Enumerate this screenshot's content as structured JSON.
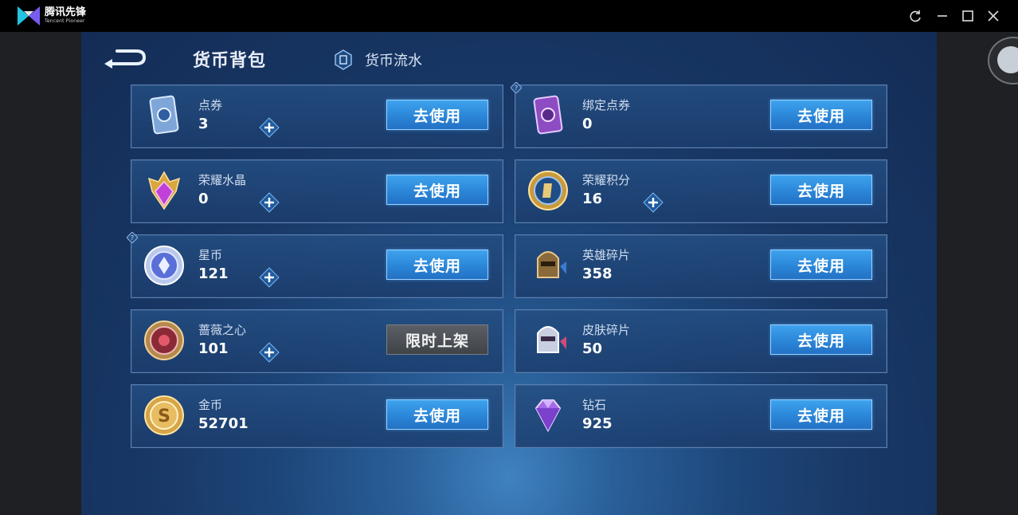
{
  "app": {
    "name": "腾讯先锋",
    "subtitle": "Tencent Pioneer"
  },
  "header": {
    "tab_wallet": "货币背包",
    "tab_flow": "货币流水"
  },
  "cards": [
    {
      "name": "点券",
      "value": "3",
      "button": "去使用",
      "has_plus": true,
      "icon": "coupon-card-icon"
    },
    {
      "name": "绑定点券",
      "value": "0",
      "button": "去使用",
      "has_plus": false,
      "icon": "bound-coupon-icon"
    },
    {
      "name": "荣耀水晶",
      "value": "0",
      "button": "去使用",
      "has_plus": true,
      "icon": "glory-crystal-icon"
    },
    {
      "name": "荣耀积分",
      "value": "16",
      "button": "去使用",
      "has_plus": true,
      "icon": "glory-points-icon"
    },
    {
      "name": "星币",
      "value": "121",
      "button": "去使用",
      "has_plus": true,
      "icon": "star-coin-icon"
    },
    {
      "name": "英雄碎片",
      "value": "358",
      "button": "去使用",
      "has_plus": false,
      "icon": "hero-fragment-icon"
    },
    {
      "name": "蔷薇之心",
      "value": "101",
      "button": "限时上架",
      "has_plus": true,
      "icon": "rose-heart-icon"
    },
    {
      "name": "皮肤碎片",
      "value": "50",
      "button": "去使用",
      "has_plus": false,
      "icon": "skin-fragment-icon"
    },
    {
      "name": "金币",
      "value": "52701",
      "button": "去使用",
      "has_plus": false,
      "icon": "gold-coin-icon"
    },
    {
      "name": "钻石",
      "value": "925",
      "button": "去使用",
      "has_plus": false,
      "icon": "diamond-icon"
    }
  ],
  "colors": {
    "accent": "#2b86d8",
    "panel": "#1b3c6c",
    "border": "#5b7fb0"
  }
}
